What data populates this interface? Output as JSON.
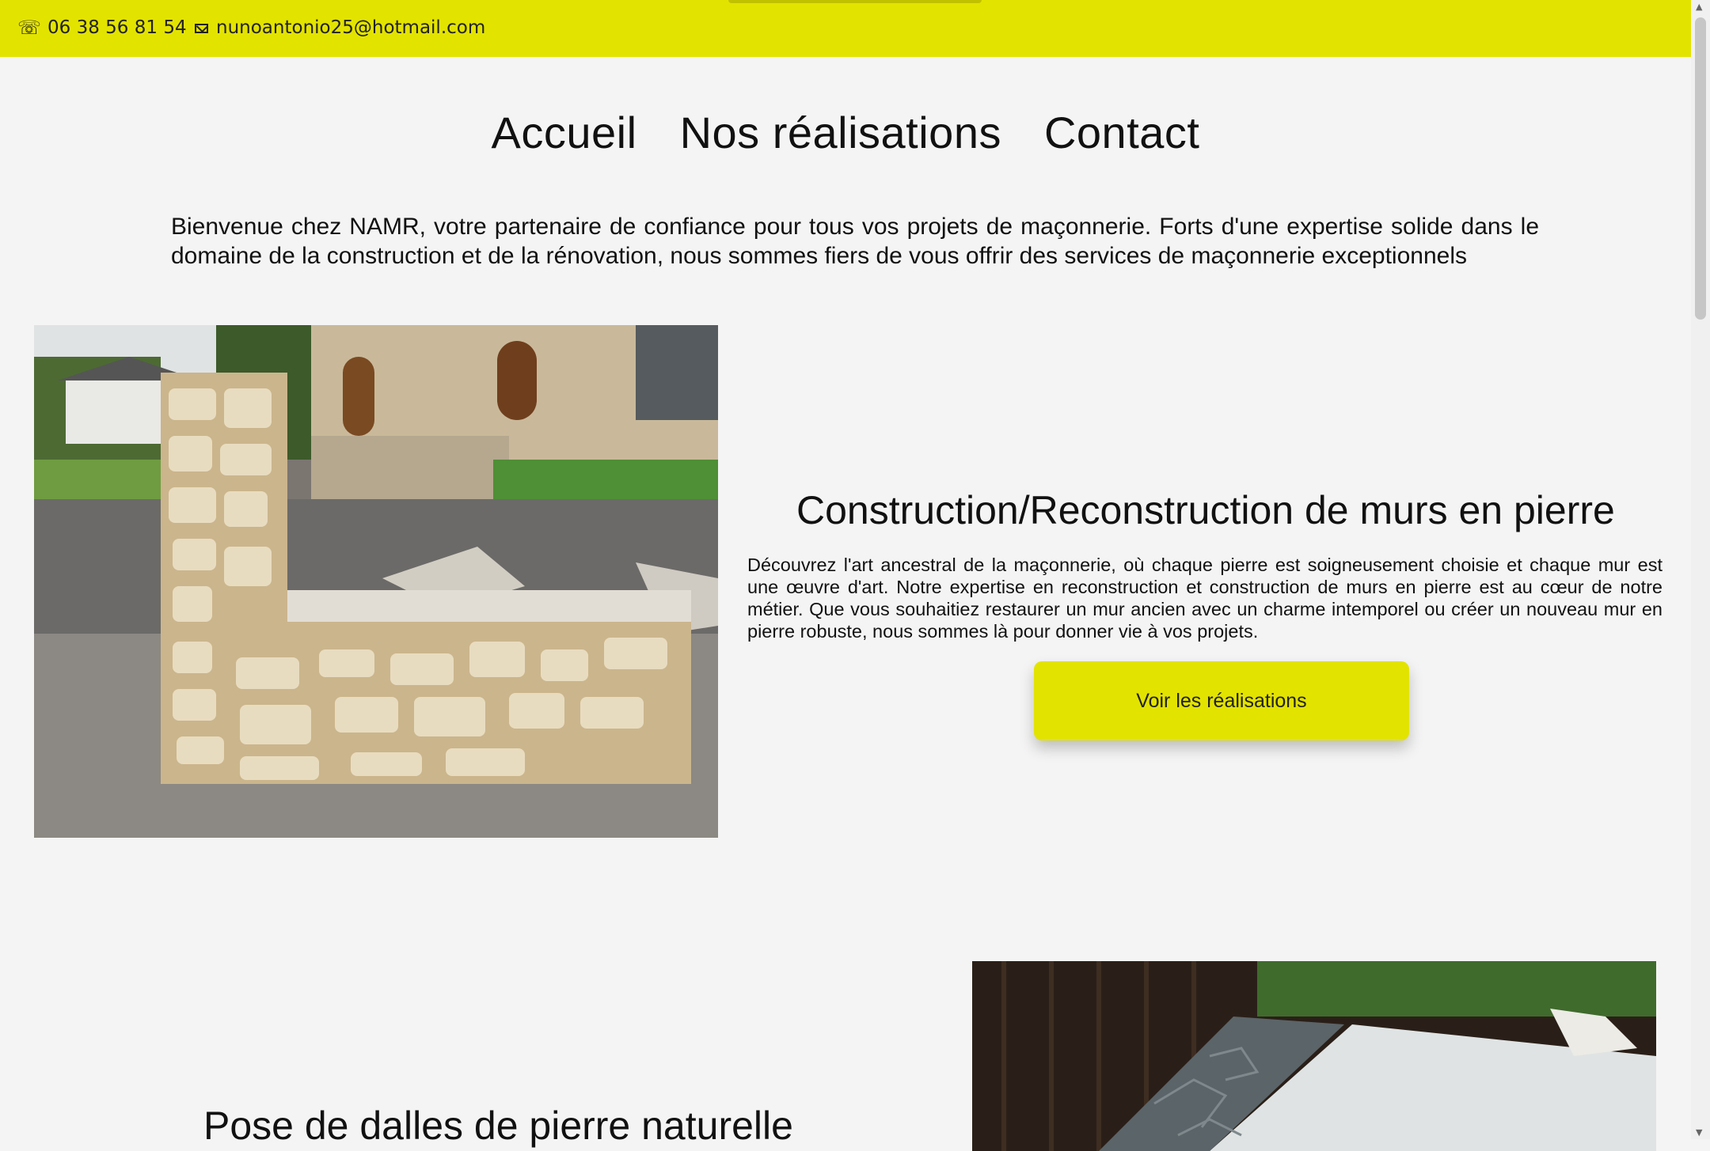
{
  "topbar": {
    "phone": "06 38 56 81 54",
    "email": "nunoantonio25@hotmail.com",
    "background_color": "#e3e300",
    "phone_icon": "phone-icon",
    "email_icon": "mail-icon"
  },
  "nav": {
    "items": [
      "Accueil",
      "Nos réalisations",
      "Contact"
    ]
  },
  "intro": {
    "text": "Bienvenue chez NAMR, votre partenaire de confiance pour tous vos projets de maçonnerie. Forts d'une expertise solide dans le domaine de la construction et de la rénovation, nous sommes fiers de vous offrir des services de maçonnerie exceptionnels"
  },
  "sections": [
    {
      "title": "Construction/Reconstruction de murs en pierre",
      "text": "Découvrez l'art ancestral de la maçonnerie, où chaque pierre est soigneusement choisie et chaque mur est une œuvre d'art. Notre expertise en reconstruction et construction de murs en pierre est au cœur de notre métier. Que vous souhaitiez restaurer un mur ancien avec un charme intemporel ou créer un nouveau mur en pierre robuste, nous sommes là pour donner vie à vos projets.",
      "button": "Voir les réalisations"
    },
    {
      "title": "Pose de dalles de pierre naturelle"
    }
  ],
  "accent_color": "#e3e300"
}
